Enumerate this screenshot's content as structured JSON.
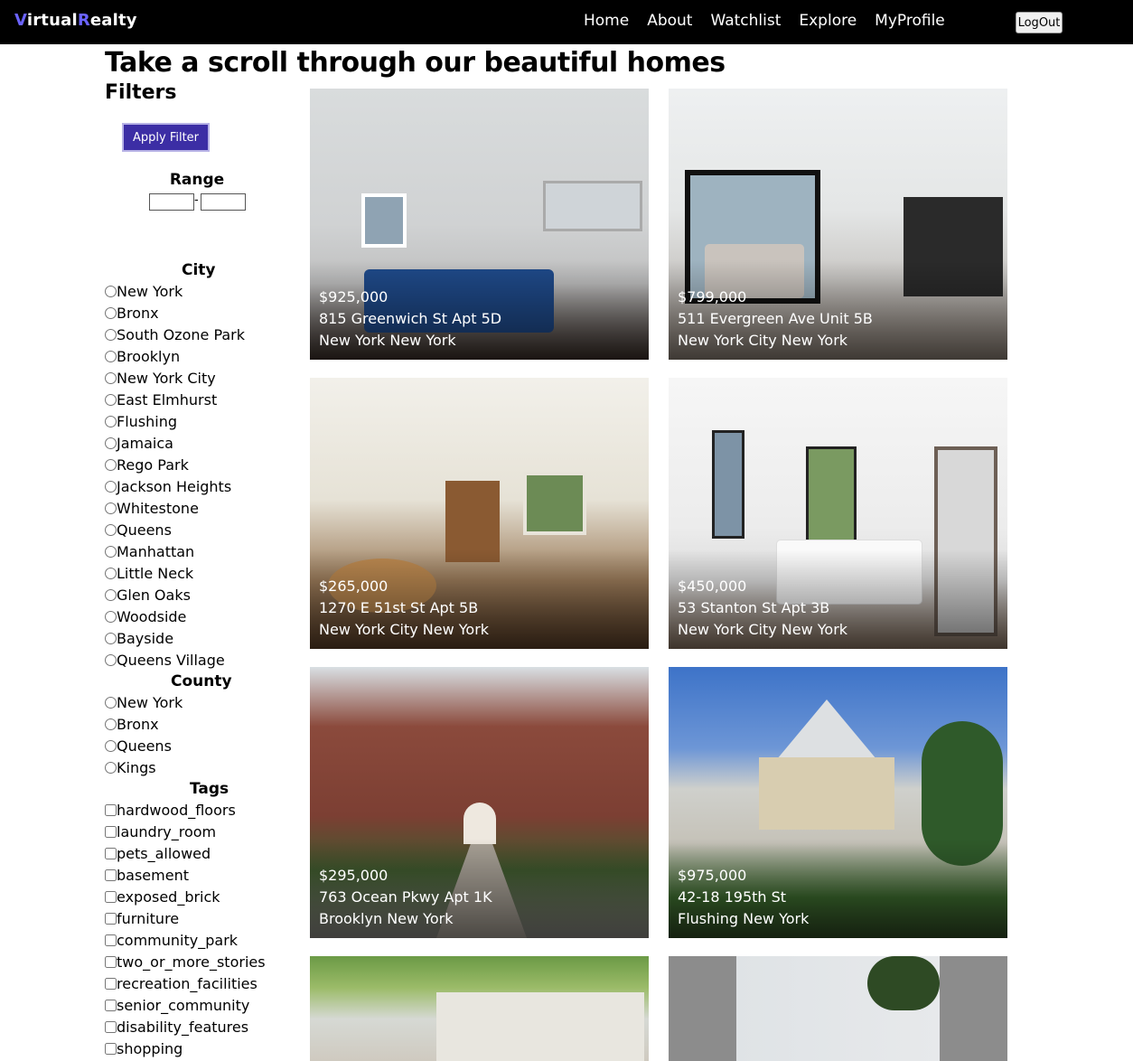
{
  "nav": {
    "logo_v": "V",
    "logo_irtual": "irtual",
    "logo_r": "R",
    "logo_ealty": "ealty",
    "links": [
      "Home",
      "About",
      "Watchlist",
      "Explore",
      "MyProfile"
    ],
    "logout_label": "LogOut"
  },
  "page": {
    "title": "Take a scroll through our beautiful homes"
  },
  "filters": {
    "title": "Filters",
    "apply_label": "Apply Filter",
    "range": {
      "title": "Range",
      "min_value": "",
      "max_value": "",
      "separator": "-"
    },
    "city": {
      "title": "City",
      "options": [
        "New York",
        "Bronx",
        "South Ozone Park",
        "Brooklyn",
        "New York City",
        "East Elmhurst",
        "Flushing",
        "Jamaica",
        "Rego Park",
        "Jackson Heights",
        "Whitestone",
        "Queens",
        "Manhattan",
        "Little Neck",
        "Glen Oaks",
        "Woodside",
        "Bayside",
        "Queens Village"
      ]
    },
    "county": {
      "title": "County",
      "options": [
        "New York",
        "Bronx",
        "Queens",
        "Kings"
      ]
    },
    "tags": {
      "title": "Tags",
      "options": [
        "hardwood_floors",
        "laundry_room",
        "pets_allowed",
        "basement",
        "exposed_brick",
        "furniture",
        "community_park",
        "two_or_more_stories",
        "recreation_facilities",
        "senior_community",
        "disability_features",
        "shopping"
      ]
    }
  },
  "listings": [
    {
      "price": "$925,000",
      "address": "815 Greenwich St Apt 5D",
      "location": "New York New York"
    },
    {
      "price": "$799,000",
      "address": "511 Evergreen Ave Unit 5B",
      "location": "New York City New York"
    },
    {
      "price": "$265,000",
      "address": "1270 E 51st St Apt 5B",
      "location": "New York City New York"
    },
    {
      "price": "$450,000",
      "address": "53 Stanton St Apt 3B",
      "location": "New York City New York"
    },
    {
      "price": "$295,000",
      "address": "763 Ocean Pkwy Apt 1K",
      "location": "Brooklyn New York"
    },
    {
      "price": "$975,000",
      "address": "42-18 195th St",
      "location": "Flushing New York"
    }
  ],
  "colors": {
    "nav_bg": "#000000",
    "logo_accent": "#6b63ff",
    "apply_button": "#3c2ea5"
  }
}
